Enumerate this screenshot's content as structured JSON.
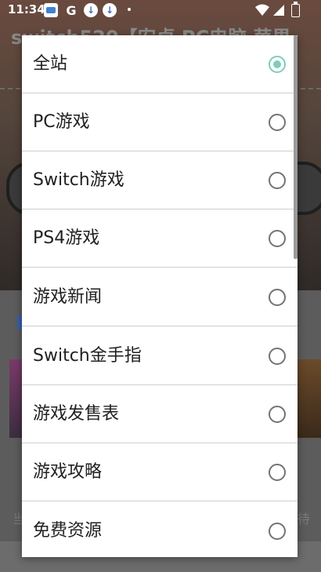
{
  "status_bar": {
    "time": "11:34",
    "icons": [
      "photo-icon",
      "google-icon",
      "download-icon",
      "download-icon",
      "dot-icon",
      "wifi-icon",
      "signal-icon",
      "battery-icon"
    ],
    "g_glyph": "G",
    "dot_glyph": "•"
  },
  "background": {
    "title": "switch520【安卓 PC电脑 苹果",
    "footer_left": "当",
    "footer_right": "待"
  },
  "dialog": {
    "selected_index": 0,
    "accent_color": "#7ecdbd",
    "options": [
      {
        "label": "全站",
        "checked": true
      },
      {
        "label": "PC游戏",
        "checked": false
      },
      {
        "label": "Switch游戏",
        "checked": false
      },
      {
        "label": "PS4游戏",
        "checked": false
      },
      {
        "label": "游戏新闻",
        "checked": false
      },
      {
        "label": "Switch金手指",
        "checked": false
      },
      {
        "label": "游戏发售表",
        "checked": false
      },
      {
        "label": "游戏攻略",
        "checked": false
      },
      {
        "label": "免费资源",
        "checked": false
      }
    ]
  }
}
